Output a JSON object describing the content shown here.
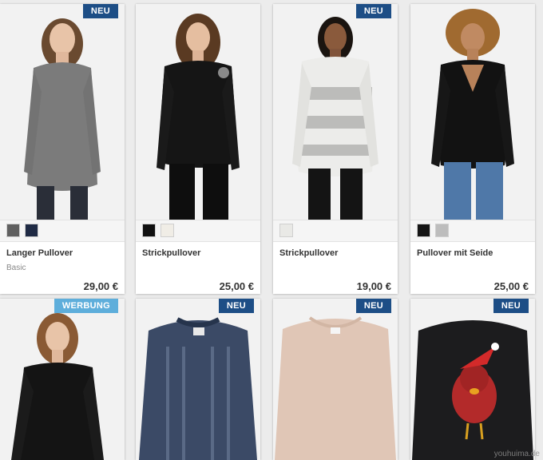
{
  "products": [
    {
      "name": "Langer Pullover",
      "sub": "Basic",
      "price": "29,00 €",
      "badge": "NEU",
      "swatches": [
        "#606060",
        "#1f2a44"
      ]
    },
    {
      "name": "Strickpullover",
      "sub": "",
      "price": "25,00 €",
      "badge": "",
      "swatches": [
        "#111111",
        "#f0ede6"
      ]
    },
    {
      "name": "Strickpullover",
      "sub": "",
      "price": "19,00 €",
      "badge": "NEU",
      "swatches": [
        "#e9e9e6"
      ]
    },
    {
      "name": "Pullover mit Seide",
      "sub": "",
      "price": "25,00 €",
      "badge": "",
      "swatches": [
        "#151515",
        "#bdbdbd"
      ]
    },
    {
      "name": "",
      "sub": "",
      "price": "",
      "badge": "WERBUNG",
      "swatches": []
    },
    {
      "name": "",
      "sub": "",
      "price": "",
      "badge": "NEU",
      "swatches": []
    },
    {
      "name": "",
      "sub": "",
      "price": "",
      "badge": "NEU",
      "swatches": []
    },
    {
      "name": "",
      "sub": "",
      "price": "",
      "badge": "NEU",
      "swatches": []
    }
  ],
  "watermark": "youhuima.de",
  "colors": {
    "badge_neu": "#1d4e86",
    "badge_werbung": "#5eaedb",
    "background": "#ececec"
  }
}
